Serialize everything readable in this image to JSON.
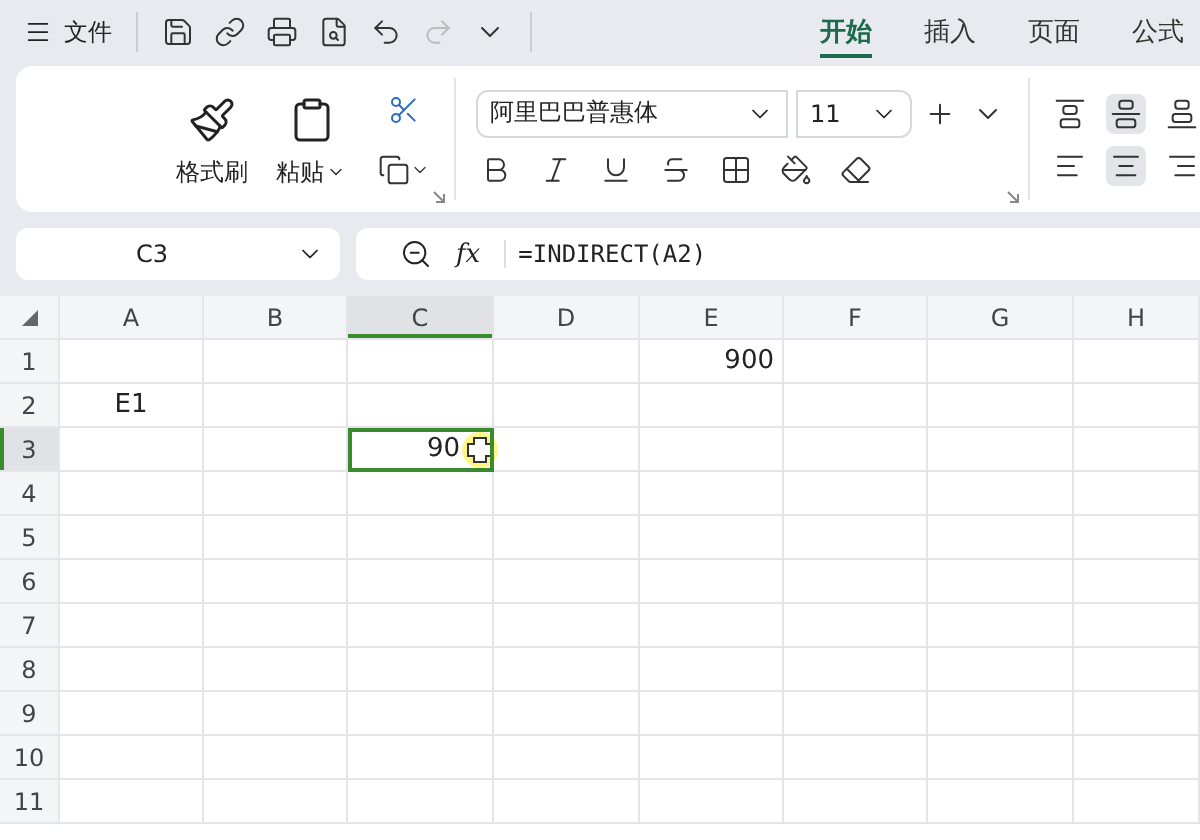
{
  "menu": {
    "label": "文件"
  },
  "tabs": [
    {
      "label": "开始",
      "selected": true
    },
    {
      "label": "插入",
      "selected": false
    },
    {
      "label": "页面",
      "selected": false
    },
    {
      "label": "公式",
      "selected": false
    }
  ],
  "clipboard": {
    "format_painter": "格式刷",
    "paste": "粘贴"
  },
  "font": {
    "name": "阿里巴巴普惠体",
    "size": "11"
  },
  "name_box": "C3",
  "function_label": "fx",
  "formula": "=INDIRECT(A2)",
  "columns": [
    {
      "label": "A",
      "selected": false
    },
    {
      "label": "B",
      "selected": false
    },
    {
      "label": "C",
      "selected": true
    },
    {
      "label": "D",
      "selected": false
    },
    {
      "label": "E",
      "selected": false
    },
    {
      "label": "F",
      "selected": false
    },
    {
      "label": "G",
      "selected": false
    },
    {
      "label": "H",
      "selected": false
    }
  ],
  "rows": [
    {
      "header": "1",
      "selected": false,
      "cells": [
        null,
        null,
        null,
        null,
        "900",
        null,
        null,
        null
      ]
    },
    {
      "header": "2",
      "selected": false,
      "cells": [
        "E1",
        null,
        null,
        null,
        null,
        null,
        null,
        null
      ]
    },
    {
      "header": "3",
      "selected": true,
      "cells": [
        null,
        null,
        "90",
        null,
        null,
        null,
        null,
        null
      ]
    },
    {
      "header": "4",
      "selected": false,
      "cells": [
        null,
        null,
        null,
        null,
        null,
        null,
        null,
        null
      ]
    },
    {
      "header": "5",
      "selected": false,
      "cells": [
        null,
        null,
        null,
        null,
        null,
        null,
        null,
        null
      ]
    },
    {
      "header": "6",
      "selected": false,
      "cells": [
        null,
        null,
        null,
        null,
        null,
        null,
        null,
        null
      ]
    },
    {
      "header": "7",
      "selected": false,
      "cells": [
        null,
        null,
        null,
        null,
        null,
        null,
        null,
        null
      ]
    },
    {
      "header": "8",
      "selected": false,
      "cells": [
        null,
        null,
        null,
        null,
        null,
        null,
        null,
        null
      ]
    },
    {
      "header": "9",
      "selected": false,
      "cells": [
        null,
        null,
        null,
        null,
        null,
        null,
        null,
        null
      ]
    },
    {
      "header": "10",
      "selected": false,
      "cells": [
        null,
        null,
        null,
        null,
        null,
        null,
        null,
        null
      ]
    },
    {
      "header": "11",
      "selected": false,
      "cells": [
        null,
        null,
        null,
        null,
        null,
        null,
        null,
        null
      ]
    }
  ]
}
